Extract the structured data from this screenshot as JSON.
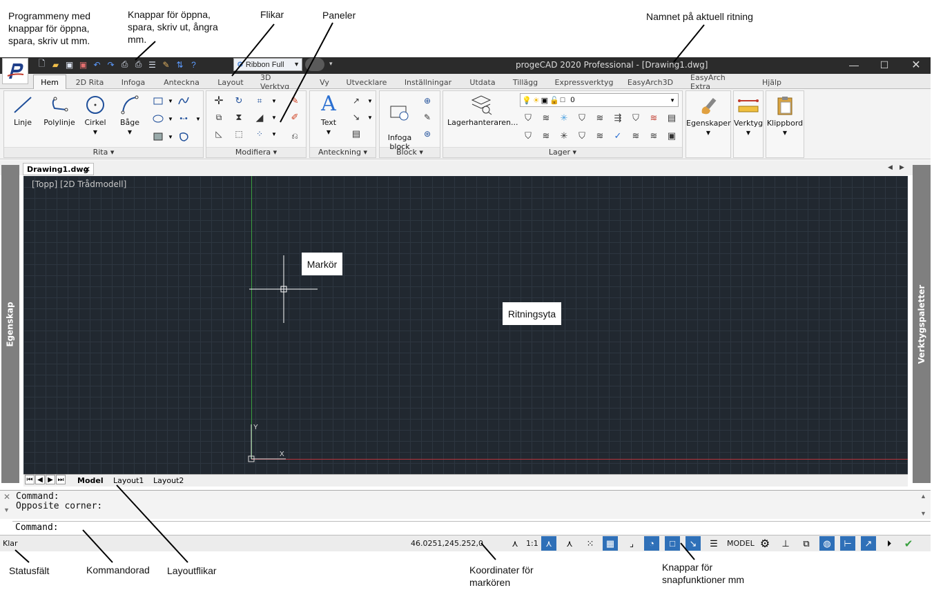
{
  "annotations": {
    "program_menu": "Programmeny med\nknappar för öppna,\nspara, skriv ut mm.",
    "qat_buttons": "Knappar för öppna,\nspara, skriv ut, ångra\nmm.",
    "tabs": "Flikar",
    "panels": "Paneler",
    "drawing_name": "Namnet på aktuell ritning",
    "cursor": "Markör",
    "drawing_area": "Ritningsyta",
    "status_bar": "Statusfält",
    "command_line": "Kommandorad",
    "layout_tabs": "Layoutflikar",
    "coordinates": "Koordinater för\nmarkören",
    "snap_buttons": "Knappar för\nsnapfunktioner mm"
  },
  "window": {
    "title": "progeCAD 2020 Professional - [Drawing1.dwg]",
    "ribbon_select": "Ribbon Full"
  },
  "tabs": [
    "Hem",
    "2D Rita",
    "Infoga",
    "Anteckna",
    "Layout",
    "3D Verktyg",
    "Vy",
    "Utvecklare",
    "Inställningar",
    "Utdata",
    "Tillägg",
    "Expressverktyg",
    "EasyArch3D",
    "EasyArch Extra",
    "Hjälp"
  ],
  "panels": {
    "rita": {
      "label": "Rita ▾",
      "tools": [
        "Linje",
        "Polylinje",
        "Cirkel",
        "Båge"
      ]
    },
    "modifiera": {
      "label": "Modifiera ▾"
    },
    "anteckning": {
      "label": "Anteckning ▾",
      "tool": "Text"
    },
    "block": {
      "label": "Block ▾",
      "tool": "Infoga\nblock"
    },
    "lager": {
      "label": "Lager ▾",
      "tool": "Lagerhanteraren...",
      "current_layer": "0"
    },
    "egenskaper": {
      "label": "Egenskaper"
    },
    "verktyg": {
      "label": "Verktyg"
    },
    "klippbord": {
      "label": "Klippbord"
    }
  },
  "document": {
    "tab": "Drawing1.dwg",
    "viewport_label": "[Topp] [2D Trådmodell]"
  },
  "side_panels": {
    "left": "Egenskap",
    "right": "Verktygspaletter"
  },
  "layout_tabs": [
    "Model",
    "Layout1",
    "Layout2"
  ],
  "axes": {
    "x": "X",
    "y": "Y"
  },
  "command": {
    "history": [
      "Command:",
      "Opposite corner:"
    ],
    "prompt": "Command:"
  },
  "status": {
    "ready": "Klar",
    "coords": "46.0251,245.252,0",
    "scale": "1:1",
    "model": "MODEL"
  }
}
